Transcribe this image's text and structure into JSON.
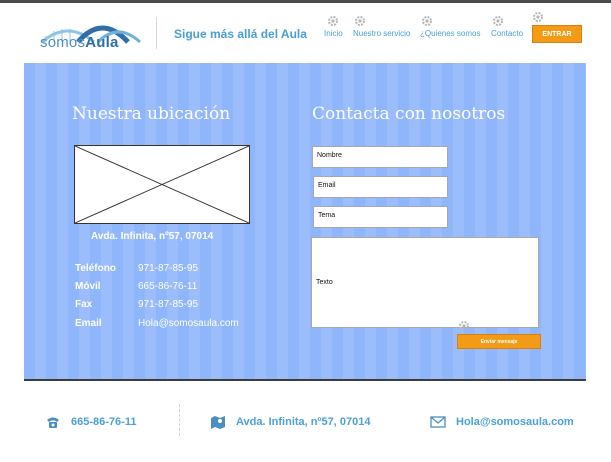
{
  "header": {
    "logo_prefix": "somos",
    "logo_suffix": "Aula",
    "tagline": "Sigue más allá del Aula",
    "nav": [
      "Inicio",
      "Nuestro servicio",
      "¿Quienes somos",
      "Contacto"
    ],
    "enter_button": "ENTRAR",
    "accent_color": "#f39a17",
    "link_color": "#4aa0d8"
  },
  "location": {
    "title": "Nuestra ubicación",
    "address": "Avda. Infinita, nº57, 07014",
    "details": [
      {
        "label": "Teléfono",
        "value": "971-87-85-95"
      },
      {
        "label": "Móvil",
        "value": "665-86-76-11"
      },
      {
        "label": "Fax",
        "value": "971-87-85-95"
      },
      {
        "label": "Email",
        "value": "Hola@somosaula.com"
      }
    ]
  },
  "contact": {
    "title": "Contacta con nosotros",
    "fields": {
      "name": "Nombre",
      "email": "Email",
      "subject": "Tema",
      "message": "Texto"
    },
    "send_button": "Enviar mensaje",
    "band_color": "#8fb5fb"
  },
  "footer": {
    "phone": "665-86-76-11",
    "address": "Avda. Infinita, nº57, 07014",
    "email": "Hola@somosaula.com",
    "icons": [
      "phone-icon",
      "map-icon",
      "mail-icon"
    ]
  }
}
